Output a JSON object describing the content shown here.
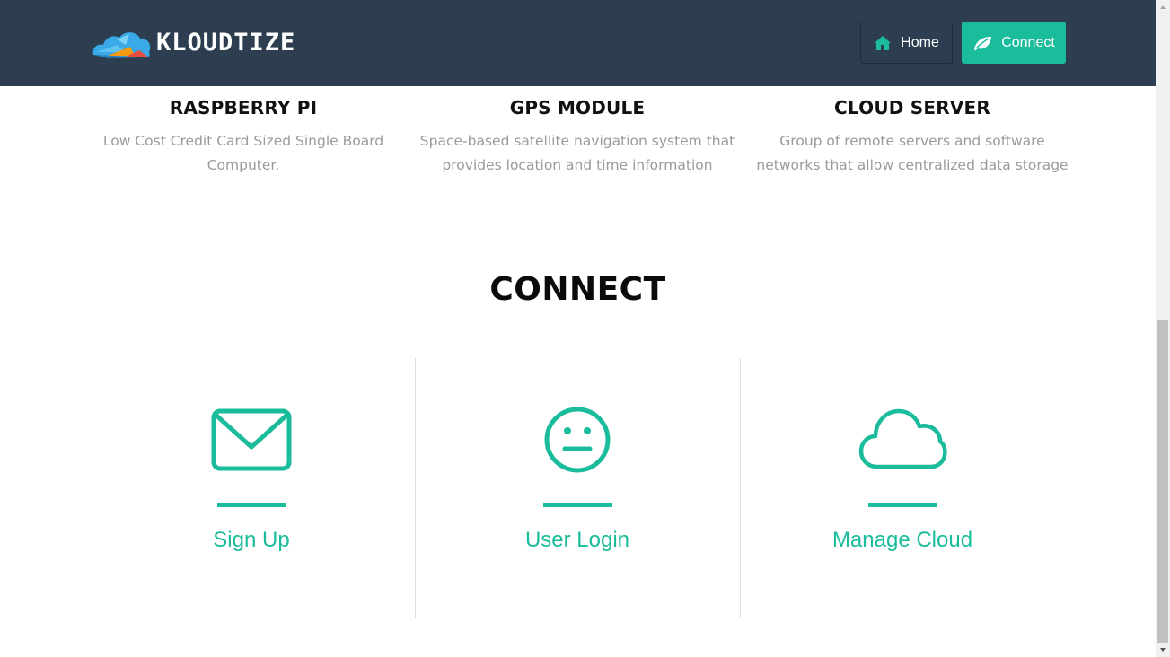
{
  "header": {
    "brand": "KLOUDTIZE",
    "nav": [
      {
        "label": "Home",
        "icon": "home-icon"
      },
      {
        "label": "Connect",
        "icon": "leaf-icon"
      }
    ]
  },
  "features": [
    {
      "title": "RASPBERRY PI",
      "line1": "Low Cost Credit Card Sized Single Board",
      "line2": "Computer."
    },
    {
      "title": "GPS MODULE",
      "line1": "Space-based satellite navigation system that",
      "line2": "provides location and time information"
    },
    {
      "title": "CLOUD SERVER",
      "line1": "Group of remote servers and software",
      "line2": "networks that allow centralized data storage"
    }
  ],
  "connect": {
    "title": "CONNECT",
    "cards": [
      {
        "label": "Sign Up",
        "icon": "envelope-icon"
      },
      {
        "label": "User Login",
        "icon": "neutral-face-icon"
      },
      {
        "label": "Manage Cloud",
        "icon": "cloud-icon"
      }
    ]
  },
  "colors": {
    "navbar": "#2c3e50",
    "accent": "#1abc9c",
    "muted_text": "#9a9a9a"
  }
}
